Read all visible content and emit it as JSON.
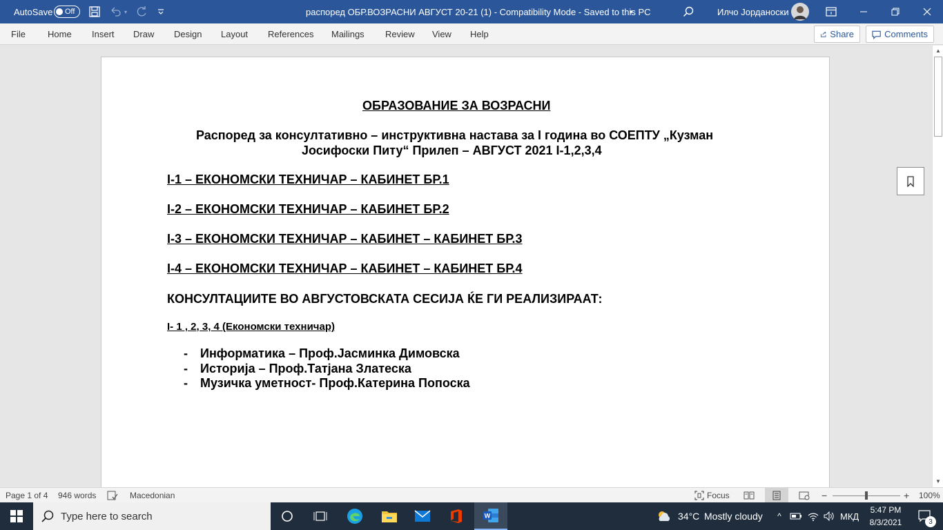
{
  "titlebar": {
    "autosave_label": "AutoSave",
    "autosave_state": "Off",
    "doc_title": "распоред ОБР.ВОЗРАСНИ АВГУСТ  20-21 (1)  -  Compatibility Mode  -  Saved to this PC",
    "user_name": "Илчо Јорданоски"
  },
  "ribbon": {
    "tabs": [
      "File",
      "Home",
      "Insert",
      "Draw",
      "Design",
      "Layout",
      "References",
      "Mailings",
      "Review",
      "View",
      "Help"
    ],
    "share_label": "Share",
    "comments_label": "Comments"
  },
  "document": {
    "heading": "ОБРАЗОВАНИЕ  ЗА  ВОЗРАСНИ",
    "subtitle_line1": "Распоред за консултативно – инструктивна настава за I година во СОЕПТУ „Кузман",
    "subtitle_line2": "Јосифоски Питу“ Прилеп – АВГУСТ  2021     I-1,2,3,4",
    "classes": [
      "I-1 – ЕКОНОМСКИ ТЕХНИЧАР – КАБИНЕТ БР.1",
      "I-2 – ЕКОНОМСКИ ТЕХНИЧАР – КАБИНЕТ БР.2",
      "I-3 – ЕКОНОМСКИ ТЕХНИЧАР – КАБИНЕТ – КАБИНЕТ БР.3",
      "I-4 – ЕКОНОМСКИ ТЕХНИЧАР – КАБИНЕТ – КАБИНЕТ БР.4"
    ],
    "consult_heading": "КОНСУЛТАЦИИТЕ ВО АВГУСТОВСКАТА  СЕСИЈА ЌЕ ГИ РЕАЛИЗИРААТ:",
    "group_label": "I- 1 , 2, 3, 4 (Економски техничар)",
    "teachers": [
      "Информатика – Проф.Јасминка Димовска",
      "Историја – Проф.Татјана Златеска",
      "Музичка уметност- Проф.Катерина Попоска"
    ],
    "bullet": "-"
  },
  "statusbar": {
    "page_info": "Page 1 of 4",
    "word_count": "946 words",
    "language": "Macedonian",
    "focus_label": "Focus",
    "zoom": "100%"
  },
  "taskbar": {
    "search_placeholder": "Type here to search",
    "weather_temp": "34°C",
    "weather_text": "Mostly cloudy",
    "input_lang": "МКД",
    "time": "5:47 PM",
    "date": "8/3/2021",
    "notification_count": "3"
  },
  "colors": {
    "word_blue": "#2b579a",
    "taskbar_bg": "#1f2d3c"
  }
}
